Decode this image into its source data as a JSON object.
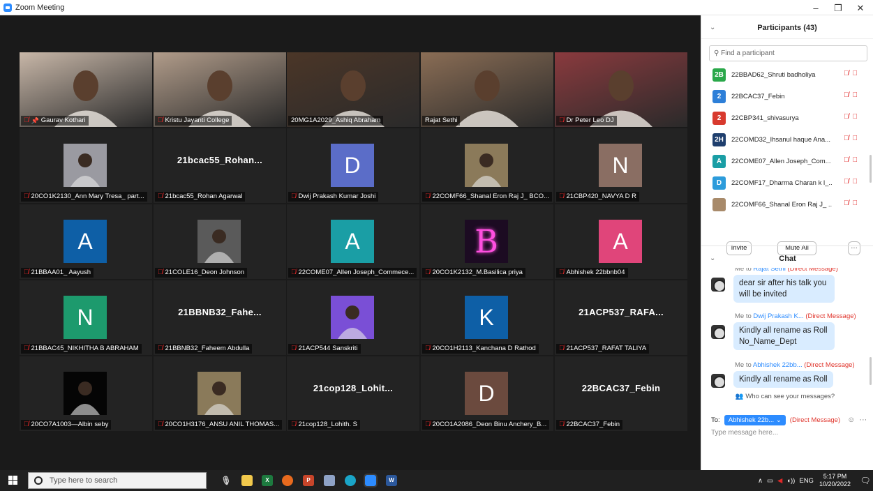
{
  "window": {
    "title": "Zoom Meeting"
  },
  "tiles": [
    {
      "name": "Gaurav Kothari",
      "kind": "video",
      "pinned": true,
      "color": "#c8b7a8"
    },
    {
      "name": "Kristu Jayanti College",
      "kind": "video",
      "color": "#b19c8a"
    },
    {
      "name": "20MG1A2029_Ashiq Abraham",
      "kind": "video",
      "speaking": true,
      "muted": false,
      "color": "#4b3628"
    },
    {
      "name": "Rajat Sethi",
      "kind": "video",
      "muted": false,
      "color": "#8a6d55"
    },
    {
      "name": "Dr Peter Leo DJ",
      "kind": "video",
      "color": "#8a3a3e"
    },
    {
      "name": "20CO1K2130_Ann Mary Tresa_ part...",
      "kind": "pic",
      "color": "#9a9aa1"
    },
    {
      "name": "21bcac55_Rohan Agarwal",
      "kind": "text",
      "big": "21bcac55_Rohan..."
    },
    {
      "name": "Dwij Prakash Kumar Joshi",
      "kind": "avatar",
      "letter": "D",
      "color": "#5b6dc8"
    },
    {
      "name": "22COMF66_Shanal Eron Raj J_ BCO...",
      "kind": "pic",
      "color": "#8b7a5a"
    },
    {
      "name": "21CBP420_NAVYA D R",
      "kind": "avatar",
      "letter": "N",
      "color": "#8a6e63"
    },
    {
      "name": "21BBAA01_ Aayush",
      "kind": "avatar",
      "letter": "A",
      "color": "#0e5fa6"
    },
    {
      "name": "21COLE16_Deon Johnson",
      "kind": "pic",
      "color": "#5a5a5a"
    },
    {
      "name": "22COME07_Allen Joseph_Commece...",
      "kind": "avatar",
      "letter": "A",
      "color": "#1a9ea5"
    },
    {
      "name": "20CO1K2132_M.Basilica priya",
      "kind": "pic",
      "letter": "B",
      "color": "#1c0b22"
    },
    {
      "name": "Abhishek 22bbnb04",
      "kind": "avatar",
      "letter": "A",
      "color": "#e0457a"
    },
    {
      "name": "21BBAC45_NIKHITHA B ABRAHAM",
      "kind": "avatar",
      "letter": "N",
      "color": "#1d9a6d"
    },
    {
      "name": "21BBNB32_Faheem Abdulla",
      "kind": "text",
      "big": "21BBNB32_Fahe..."
    },
    {
      "name": "21ACP544 Sanskriti",
      "kind": "pic",
      "color": "#7a4fd6"
    },
    {
      "name": "20CO1H2113_Kanchana D Rathod",
      "kind": "avatar",
      "letter": "K",
      "color": "#0e5fa6"
    },
    {
      "name": "21ACP537_RAFAT TALIYA",
      "kind": "text",
      "big": "21ACP537_RAFA..."
    },
    {
      "name": "20CO7A1003—Albin seby",
      "kind": "pic",
      "color": "#050505"
    },
    {
      "name": "20CO1H3176_ANSU ANIL THOMAS...",
      "kind": "pic",
      "color": "#8a7a5a"
    },
    {
      "name": "21cop128_Lohith. S",
      "kind": "text",
      "big": "21cop128_Lohit..."
    },
    {
      "name": "20CO1A2086_Deon Binu Anchery_B...",
      "kind": "avatar",
      "letter": "D",
      "color": "#6b4a3e"
    },
    {
      "name": "22BCAC37_Febin",
      "kind": "text",
      "big": "22BCAC37_Febin"
    }
  ],
  "participants": {
    "title": "Participants (43)",
    "search_placeholder": "Find a participant",
    "invite_label": "Invite",
    "mute_all_label": "Mute All",
    "more_label": "···",
    "list": [
      {
        "badge": "2B",
        "name": "22BBAD62_Shruti badholiya",
        "color": "#2aa84a"
      },
      {
        "badge": "2",
        "name": "22BCAC37_Febin",
        "color": "#2d7fd8"
      },
      {
        "badge": "2",
        "name": "22CBP341_shivasurya",
        "color": "#d83a2e"
      },
      {
        "badge": "2H",
        "name": "22COMD32_Ihsanul haque Ana...",
        "color": "#1f3f6e"
      },
      {
        "badge": "A",
        "name": "22COME07_Allen Joseph_Com...",
        "color": "#1a9ea5"
      },
      {
        "badge": "D",
        "name": "22COMF17_Dharma Charan k l_...",
        "color": "#2d9cdb"
      },
      {
        "badge": "",
        "name": "22COMF66_Shanal Eron Raj J_ ...",
        "color": "#a88a6a"
      }
    ]
  },
  "chat": {
    "title": "Chat",
    "messages": [
      {
        "meta_prefix": "Me to ",
        "to": "Rajat Sethi",
        "dm": "(Direct Message)",
        "text": "dear sir after his talk you will be invited"
      },
      {
        "meta_prefix": "Me to ",
        "to": "Dwij Prakash K...",
        "dm": "(Direct Message)",
        "text": "Kindly all rename as Roll No_Name_Dept"
      },
      {
        "meta_prefix": "Me to ",
        "to": "Abhishek 22bb...",
        "dm": "(Direct Message)",
        "text": "Kindly all rename as Roll"
      }
    ],
    "who_can_see": "Who can see your messages?",
    "to_label": "To:",
    "recipient": "Abhishek 22b...",
    "dm_label": "(Direct Message)",
    "input_placeholder": "Type message here..."
  },
  "taskbar": {
    "search_placeholder": "Type here to search",
    "lang": "ENG",
    "time": "5:17 PM",
    "date": "10/20/2022"
  }
}
